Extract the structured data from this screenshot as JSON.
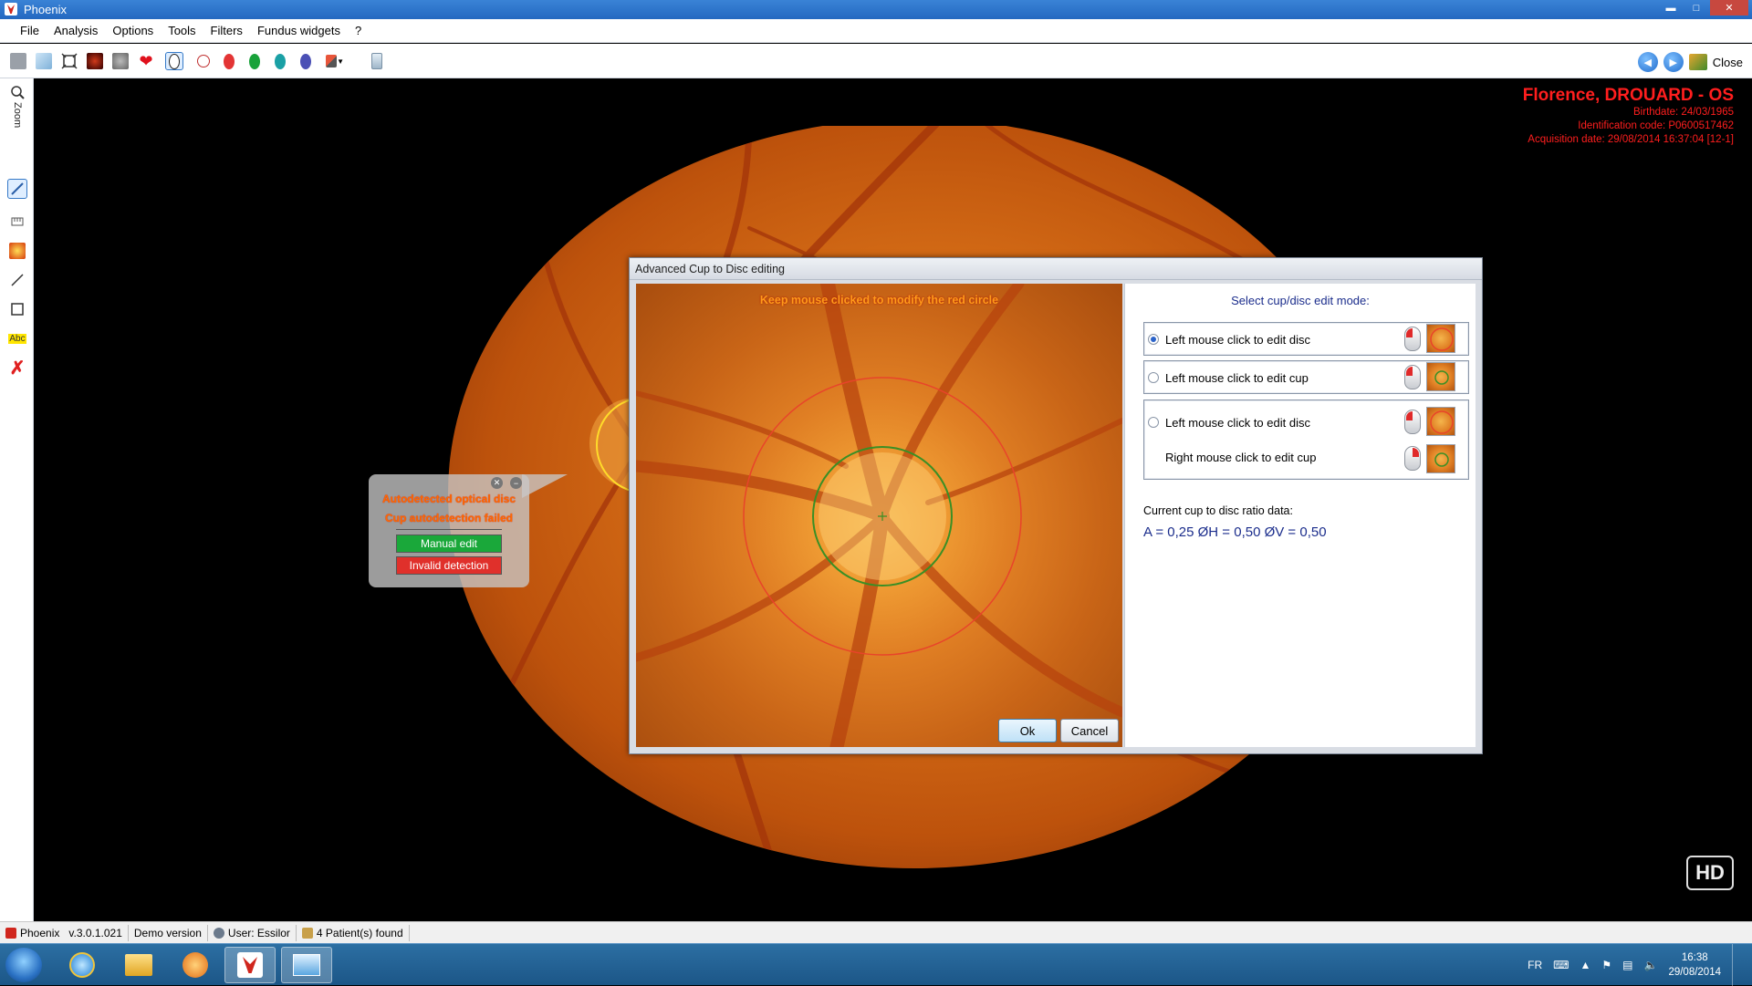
{
  "window": {
    "title": "Phoenix"
  },
  "menu": [
    "File",
    "Analysis",
    "Options",
    "Tools",
    "Filters",
    "Fundus widgets",
    "?"
  ],
  "toolbar": {
    "close_label": "Close"
  },
  "sidebar": {
    "zoom_label": "Zoom"
  },
  "patient": {
    "name": "Florence, DROUARD - OS",
    "birthdate": "Birthdate: 24/03/1965",
    "id_code": "Identification code: P0600517462",
    "acquisition": "Acquisition date: 29/08/2014 16:37:04 [12-1]"
  },
  "popup": {
    "line1": "Autodetected optical disc",
    "line2": "Cup autodetection failed",
    "manual_edit": "Manual edit",
    "invalid_detection": "Invalid detection"
  },
  "dialog": {
    "title": "Advanced Cup to Disc editing",
    "hint": "Keep mouse clicked to modify the red circle",
    "ok": "Ok",
    "cancel": "Cancel",
    "panel_title": "Select cup/disc edit mode:",
    "modes": {
      "mode1": "Left mouse click to edit disc",
      "mode2": "Left mouse click to edit cup",
      "mode3a": "Left mouse click to edit disc",
      "mode3b": "Right mouse click to edit cup"
    },
    "ratio_label": "Current cup to disc ratio data:",
    "ratio_values": "A = 0,25 ØH = 0,50 ØV = 0,50"
  },
  "badge": {
    "hd": "HD"
  },
  "status": {
    "app": "Phoenix",
    "version": "v.3.0.1.021",
    "demo": "Demo version",
    "user": "User: Essilor",
    "patients": "4 Patient(s) found"
  },
  "taskbar": {
    "lang": "FR",
    "time": "16:38",
    "date": "29/08/2014"
  },
  "colors": {
    "accent_red": "#ff1e1e",
    "disc_circle": "#e8442a",
    "cup_circle": "#3a8f25",
    "manual_edit": "#1aa83a",
    "invalid": "#e0302b"
  }
}
